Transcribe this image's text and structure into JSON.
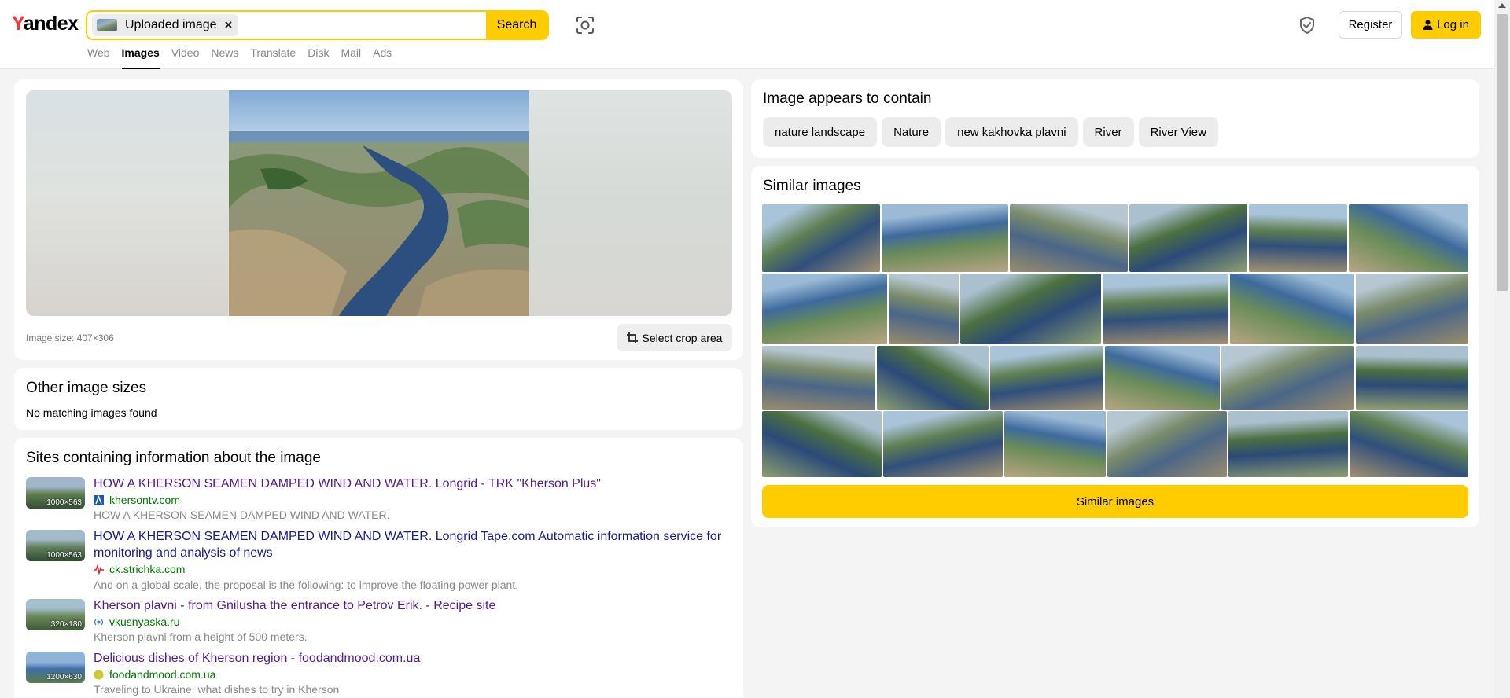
{
  "header": {
    "logo_y": "Y",
    "logo_rest": "andex",
    "search_chip_label": "Uploaded image",
    "search_chip_close": "×",
    "search_button": "Search",
    "tabs": [
      "Web",
      "Images",
      "Video",
      "News",
      "Translate",
      "Disk",
      "Mail",
      "Ads"
    ],
    "active_tab": "Images",
    "register": "Register",
    "login": "Log in"
  },
  "preview": {
    "image_size": "Image size: 407×306",
    "crop_button": "Select crop area"
  },
  "other_sizes": {
    "title": "Other image sizes",
    "message": "No matching images found"
  },
  "sites": {
    "title": "Sites containing information about the image",
    "items": [
      {
        "dim": "1000×563",
        "title": "HOW A KHERSON SEAMEN DAMPED WIND AND WATER. Longrid - TRK \"Kherson Plus\"",
        "domain": "khersontv.com",
        "desc": "HOW A KHERSON SEAMEN DAMPED WIND AND WATER."
      },
      {
        "dim": "1000×563",
        "title": "HOW A KHERSON SEAMEN DAMPED WIND AND WATER. Longrid Tape.com Automatic information service for monitoring and analysis of news",
        "domain": "ck.strichka.com",
        "desc": "And on a global scale, the proposal is the following: to improve the floating power plant."
      },
      {
        "dim": "320×180",
        "title": "Kherson plavni - from Gnilusha the entrance to Petrov Erik. - Recipe site",
        "domain": "vkusnyaska.ru",
        "desc": "Kherson plavni from a height of 500 meters."
      },
      {
        "dim": "1200×630",
        "title": "Delicious dishes of Kherson region - foodandmood.com.ua",
        "domain": "foodandmood.com.ua",
        "desc": "Traveling to Ukraine: what dishes to try in Kherson"
      }
    ]
  },
  "contains": {
    "title": "Image appears to contain",
    "tags": [
      "nature landscape",
      "Nature",
      "new kakhovka plavni",
      "River",
      "River View"
    ]
  },
  "similar": {
    "title": "Similar images",
    "button": "Similar images"
  },
  "colors": {
    "accent": "#ffcc00",
    "visited_link": "#551a8b",
    "domain_green": "#007700"
  }
}
